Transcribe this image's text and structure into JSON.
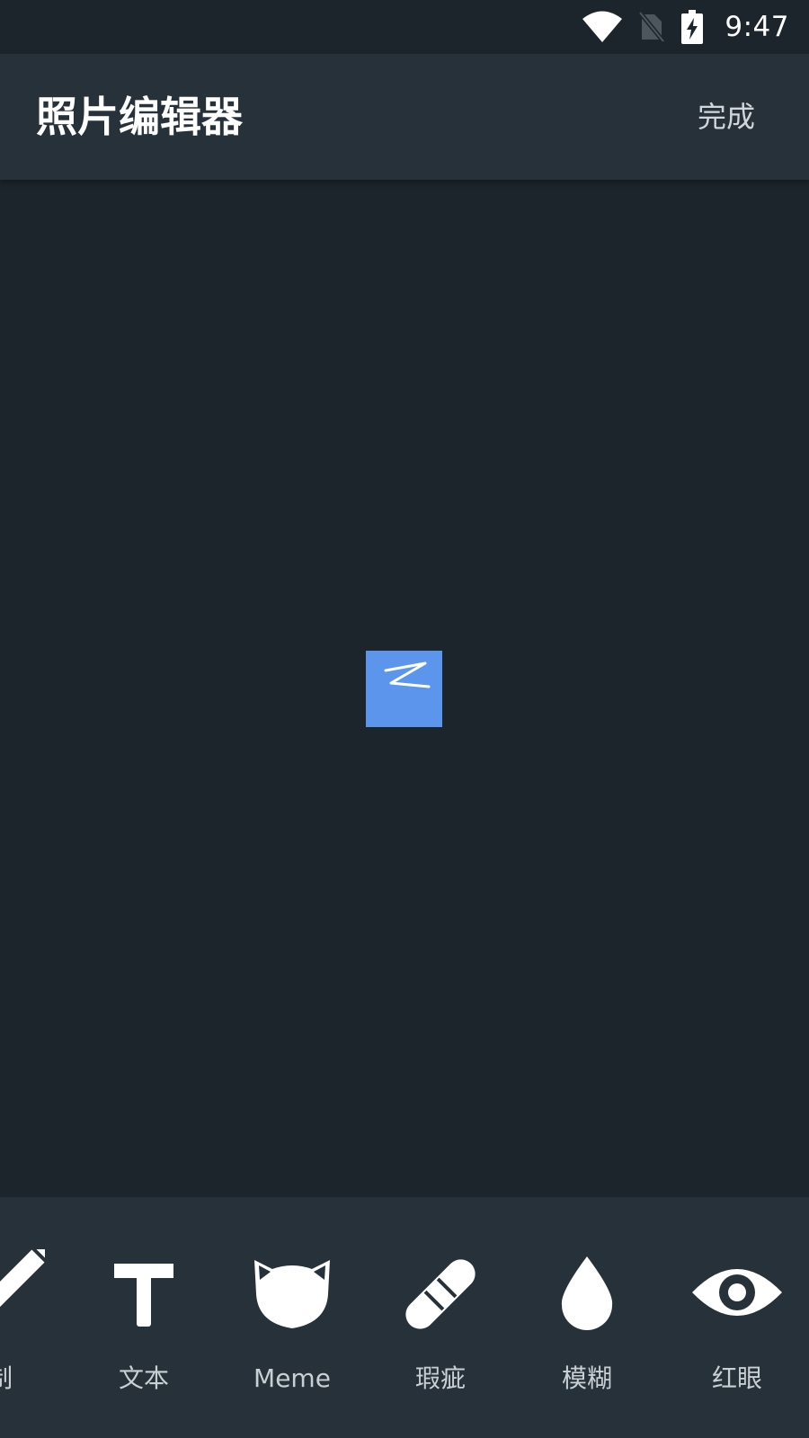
{
  "status_bar": {
    "time": "9:47",
    "icons": [
      "wifi-icon",
      "no-sim-icon",
      "battery-charging-icon"
    ]
  },
  "app_bar": {
    "title": "照片编辑器",
    "done_label": "完成"
  },
  "canvas": {
    "photo_color": "#5b95ec"
  },
  "toolbar": {
    "tools": [
      {
        "label": "制",
        "icon": "pencil-icon"
      },
      {
        "label": "文本",
        "icon": "text-icon"
      },
      {
        "label": "Meme",
        "icon": "cat-meme-icon"
      },
      {
        "label": "瑕疵",
        "icon": "bandage-icon"
      },
      {
        "label": "模糊",
        "icon": "drop-icon"
      },
      {
        "label": "红眼",
        "icon": "eye-icon"
      }
    ]
  },
  "colors": {
    "background": "#1c252b",
    "bar": "#263139",
    "accent_photo": "#5b95ec"
  }
}
